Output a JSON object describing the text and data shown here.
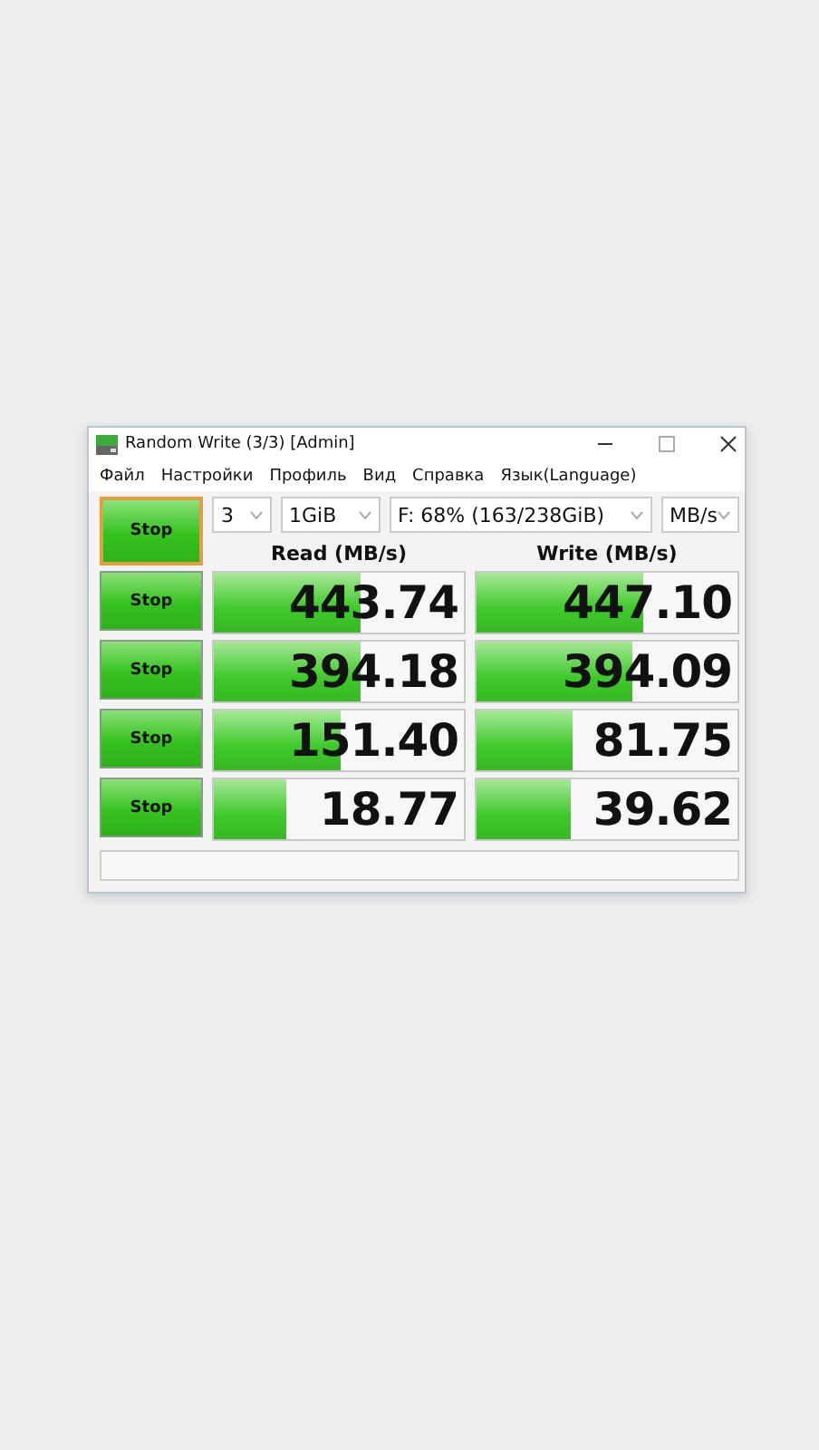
{
  "window": {
    "title": "Random Write (3/3) [Admin]"
  },
  "menu": [
    "Файл",
    "Настройки",
    "Профиль",
    "Вид",
    "Справка",
    "Язык(Language)"
  ],
  "all_button": {
    "label": "Stop",
    "focused": true
  },
  "selectors": [
    {
      "value": "3"
    },
    {
      "value": "1GiB"
    },
    {
      "value": "F: 68% (163/238GiB)"
    },
    {
      "value": "MB/s"
    }
  ],
  "columns": [
    "Read (MB/s)",
    "Write (MB/s)"
  ],
  "rows": [
    {
      "button": "Stop",
      "read": {
        "value": "443.74",
        "level": 0.59
      },
      "write": {
        "value": "447.10",
        "level": 0.64
      }
    },
    {
      "button": "Stop",
      "read": {
        "value": "394.18",
        "level": 0.59
      },
      "write": {
        "value": "394.09",
        "level": 0.6
      }
    },
    {
      "button": "Stop",
      "read": {
        "value": "151.40",
        "level": 0.51
      },
      "write": {
        "value": "81.75",
        "level": 0.37
      }
    },
    {
      "button": "Stop",
      "read": {
        "value": "18.77",
        "level": 0.29
      },
      "write": {
        "value": "39.62",
        "level": 0.36
      }
    }
  ]
}
